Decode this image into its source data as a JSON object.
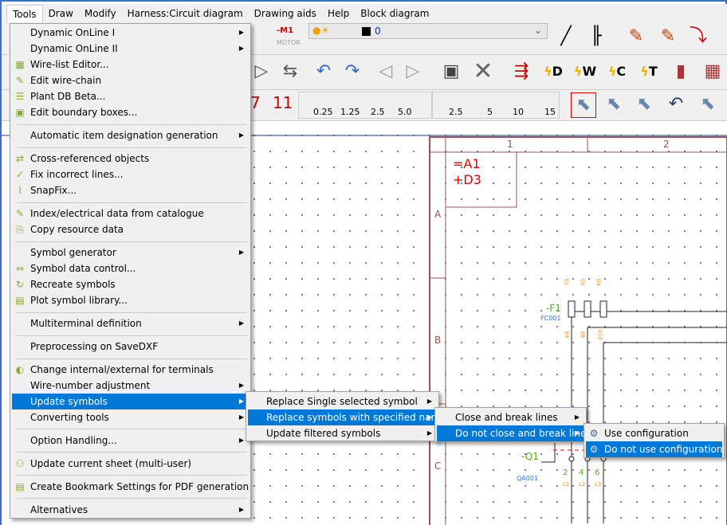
{
  "menubar": [
    "Tools",
    "Draw",
    "Modify",
    "Harness:Circuit diagram",
    "Drawing aids",
    "Help",
    "Block diagram"
  ],
  "toolbar": {
    "layer_value": "0",
    "motor_tag": "-M1",
    "motor_label": "MOTOR",
    "undo_count": "7",
    "redo_count": "11",
    "grid_red": [
      "0.25",
      "1.25",
      "2.5",
      "5.0"
    ],
    "grid_green": [
      "2.5",
      "5",
      "10",
      "15"
    ],
    "lightning": [
      "D",
      "W",
      "C",
      "T"
    ]
  },
  "tools_menu": [
    {
      "label": "Dynamic OnLine I",
      "submenu": true
    },
    {
      "label": "Dynamic OnLine II",
      "submenu": true
    },
    {
      "label": "Wire-list Editor...",
      "icon": "wire-list-icon"
    },
    {
      "label": "Edit wire-chain",
      "icon": "wire-chain-icon"
    },
    {
      "label": "Plant DB Beta...",
      "icon": "list-icon"
    },
    {
      "label": "Edit boundary boxes...",
      "icon": "boundary-box-icon"
    },
    {
      "label": "Automatic item designation generation",
      "submenu": true
    },
    {
      "label": "Cross-referenced objects",
      "icon": "cross-ref-icon"
    },
    {
      "label": "Fix incorrect lines...",
      "icon": "fix-icon"
    },
    {
      "label": "SnapFix...",
      "icon": "snapfix-icon"
    },
    {
      "label": "Index/electrical data from catalogue",
      "icon": "catalogue-icon"
    },
    {
      "label": "Copy resource data",
      "icon": "copy-icon"
    },
    {
      "label": "Symbol generator",
      "submenu": true
    },
    {
      "label": "Symbol data control...",
      "icon": "symbol-data-icon"
    },
    {
      "label": "Recreate symbols",
      "icon": "recreate-icon"
    },
    {
      "label": "Plot symbol library...",
      "icon": "plot-icon"
    },
    {
      "label": "Multiterminal definition",
      "submenu": true
    },
    {
      "label": "Preprocessing on SaveDXF"
    },
    {
      "label": "Change internal/external for terminals",
      "icon": "terminal-icon"
    },
    {
      "label": "Wire-number adjustment",
      "submenu": true
    },
    {
      "label": "Update symbols",
      "submenu": true,
      "highlighted": true
    },
    {
      "label": "Converting tools",
      "submenu": true
    },
    {
      "label": "Option Handling...",
      "submenu": true
    },
    {
      "label": "Update current sheet (multi-user)",
      "icon": "multi-user-icon"
    },
    {
      "label": "Create Bookmark Settings for PDF generation",
      "icon": "pdf-icon"
    },
    {
      "label": "Alternatives",
      "submenu": true
    }
  ],
  "update_symbols_menu": [
    "Replace Single selected symbol",
    "Replace symbols with specified name",
    "Update filtered symbols"
  ],
  "replace_menu": [
    "Close and break lines",
    "Do not close and break lines"
  ],
  "config_menu": [
    "Use configuration",
    "Do not use configuration"
  ],
  "drawing": {
    "col1": "1",
    "col2": "2",
    "rowA": "A",
    "rowB": "B",
    "rowC": "C",
    "func": "=A1",
    "loc": "+D3",
    "fuse": "-F1",
    "fuse_code": "FC001",
    "switch": "-Q1",
    "switch_code": "QA001",
    "pins_top": [
      "01",
      "05",
      "09"
    ],
    "pins_bot": [
      "04",
      "08",
      "010"
    ],
    "terms": [
      "2",
      "4",
      "6"
    ],
    "lines": [
      "L1",
      "L2",
      "L3"
    ]
  },
  "colors": {
    "highlight": "#0078d7",
    "accent_red": "#e00000",
    "frame": "#a05050"
  }
}
